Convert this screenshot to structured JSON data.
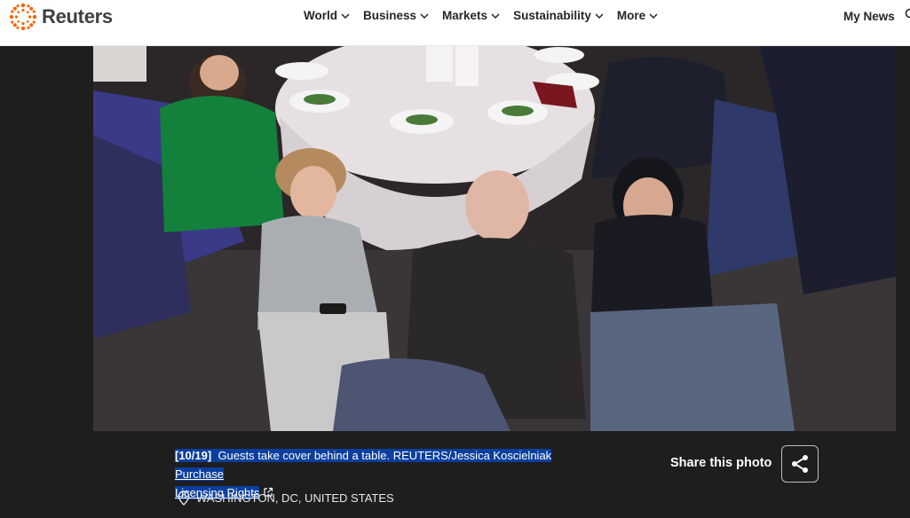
{
  "header": {
    "logo_text": "Reuters",
    "nav": [
      {
        "label": "World"
      },
      {
        "label": "Business"
      },
      {
        "label": "Markets"
      },
      {
        "label": "Sustainability"
      },
      {
        "label": "More"
      }
    ],
    "my_news": "My News"
  },
  "photo": {
    "icon": "photo-image"
  },
  "caption": {
    "index": "[10/19]",
    "text": "Guests take cover behind a table. REUTERS/Jessica Koscielniak",
    "link_purchase": "Purchase",
    "link_licensing": "Licensing Rights",
    "location": "WASHINGTON, DC, UNITED STATES"
  },
  "share": {
    "label": "Share this photo"
  },
  "colors": {
    "highlight": "#0b3f9e",
    "logo_orange": "#fa6400",
    "background": "#1e1e1e"
  }
}
